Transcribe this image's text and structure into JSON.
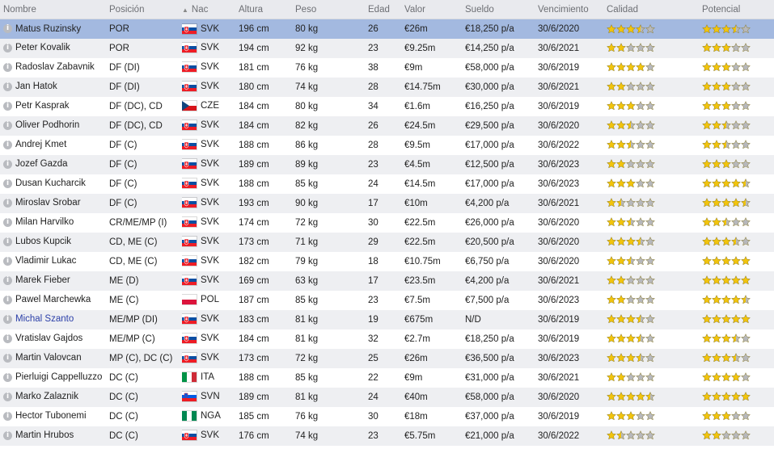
{
  "headers": {
    "name": "Nombre",
    "position": "Posición",
    "nation": "Nac",
    "height": "Altura",
    "weight": "Peso",
    "age": "Edad",
    "value": "Valor",
    "wage": "Sueldo",
    "expiry": "Vencimiento",
    "ability": "Calidad",
    "potential": "Potencial"
  },
  "sort_indicator": "▲",
  "colors": {
    "selected_row": "#a3b9e0",
    "alt_row": "#eeeff2",
    "star_gold": "#f2c40c",
    "star_grey": "#b7b8bc",
    "link": "#2b3fa8"
  },
  "players": [
    {
      "name": "Matus Ruzinsky",
      "pos": "POR",
      "nat": "SVK",
      "height": "196 cm",
      "weight": "80 kg",
      "age": "26",
      "value": "€26m",
      "wage": "€18,250 p/a",
      "expiry": "30/6/2020",
      "ability": 3.5,
      "potential": 3.5
    },
    {
      "name": "Peter Kovalik",
      "pos": "POR",
      "nat": "SVK",
      "height": "194 cm",
      "weight": "92 kg",
      "age": "23",
      "value": "€9.25m",
      "wage": "€14,250 p/a",
      "expiry": "30/6/2021",
      "ability": 2,
      "potential": 3
    },
    {
      "name": "Radoslav Zabavnik",
      "pos": "DF (DI)",
      "nat": "SVK",
      "height": "181 cm",
      "weight": "76 kg",
      "age": "38",
      "value": "€9m",
      "wage": "€58,000 p/a",
      "expiry": "30/6/2019",
      "ability": 4,
      "potential": 3
    },
    {
      "name": "Jan Hatok",
      "pos": "DF (DI)",
      "nat": "SVK",
      "height": "180 cm",
      "weight": "74 kg",
      "age": "28",
      "value": "€14.75m",
      "wage": "€30,000 p/a",
      "expiry": "30/6/2021",
      "ability": 2,
      "potential": 3
    },
    {
      "name": "Petr Kasprak",
      "pos": "DF (DC), CD",
      "nat": "CZE",
      "height": "184 cm",
      "weight": "80 kg",
      "age": "34",
      "value": "€1.6m",
      "wage": "€16,250 p/a",
      "expiry": "30/6/2019",
      "ability": 3,
      "potential": 3
    },
    {
      "name": "Oliver Podhorin",
      "pos": "DF (DC), CD",
      "nat": "SVK",
      "height": "184 cm",
      "weight": "82 kg",
      "age": "26",
      "value": "€24.5m",
      "wage": "€29,500 p/a",
      "expiry": "30/6/2020",
      "ability": 2.5,
      "potential": 2.5
    },
    {
      "name": "Andrej Kmet",
      "pos": "DF (C)",
      "nat": "SVK",
      "height": "188 cm",
      "weight": "86 kg",
      "age": "28",
      "value": "€9.5m",
      "wage": "€17,000 p/a",
      "expiry": "30/6/2022",
      "ability": 2.5,
      "potential": 2.5
    },
    {
      "name": "Jozef Gazda",
      "pos": "DF (C)",
      "nat": "SVK",
      "height": "189 cm",
      "weight": "89 kg",
      "age": "23",
      "value": "€4.5m",
      "wage": "€12,500 p/a",
      "expiry": "30/6/2023",
      "ability": 2,
      "potential": 3
    },
    {
      "name": "Dusan Kucharcik",
      "pos": "DF (C)",
      "nat": "SVK",
      "height": "188 cm",
      "weight": "85 kg",
      "age": "24",
      "value": "€14.5m",
      "wage": "€17,000 p/a",
      "expiry": "30/6/2023",
      "ability": 3,
      "potential": 4.5
    },
    {
      "name": "Miroslav Srobar",
      "pos": "DF (C)",
      "nat": "SVK",
      "height": "193 cm",
      "weight": "90 kg",
      "age": "17",
      "value": "€10m",
      "wage": "€4,200 p/a",
      "expiry": "30/6/2021",
      "ability": 1.5,
      "potential": 4.5
    },
    {
      "name": "Milan Harvilko",
      "pos": "CR/ME/MP (I)",
      "nat": "SVK",
      "height": "174 cm",
      "weight": "72 kg",
      "age": "30",
      "value": "€22.5m",
      "wage": "€26,000 p/a",
      "expiry": "30/6/2020",
      "ability": 2.5,
      "potential": 2.5
    },
    {
      "name": "Lubos Kupcik",
      "pos": "CD, ME (C)",
      "nat": "SVK",
      "height": "173 cm",
      "weight": "71 kg",
      "age": "29",
      "value": "€22.5m",
      "wage": "€20,500 p/a",
      "expiry": "30/6/2020",
      "ability": 3.5,
      "potential": 3.5
    },
    {
      "name": "Vladimir Lukac",
      "pos": "CD, ME (C)",
      "nat": "SVK",
      "height": "182 cm",
      "weight": "79 kg",
      "age": "18",
      "value": "€10.75m",
      "wage": "€6,750 p/a",
      "expiry": "30/6/2020",
      "ability": 2.5,
      "potential": 5
    },
    {
      "name": "Marek Fieber",
      "pos": "ME (D)",
      "nat": "SVK",
      "height": "169 cm",
      "weight": "63 kg",
      "age": "17",
      "value": "€23.5m",
      "wage": "€4,200 p/a",
      "expiry": "30/6/2021",
      "ability": 2,
      "potential": 5
    },
    {
      "name": "Pawel Marchewka",
      "pos": "ME (C)",
      "nat": "POL",
      "height": "187 cm",
      "weight": "85 kg",
      "age": "23",
      "value": "€7.5m",
      "wage": "€7,500 p/a",
      "expiry": "30/6/2023",
      "ability": 2,
      "potential": 4.5
    },
    {
      "name": "Michal Szanto",
      "pos": "ME/MP (DI)",
      "nat": "SVK",
      "height": "183 cm",
      "weight": "81 kg",
      "age": "19",
      "value": "€675m",
      "wage": "N/D",
      "expiry": "30/6/2019",
      "ability": 3.5,
      "potential": 5,
      "link": true
    },
    {
      "name": "Vratislav Gajdos",
      "pos": "ME/MP (C)",
      "nat": "SVK",
      "height": "184 cm",
      "weight": "81 kg",
      "age": "32",
      "value": "€2.7m",
      "wage": "€18,250 p/a",
      "expiry": "30/6/2019",
      "ability": 3.5,
      "potential": 3.5
    },
    {
      "name": "Martin Valovcan",
      "pos": "MP (C), DC (C)",
      "nat": "SVK",
      "height": "173 cm",
      "weight": "72 kg",
      "age": "25",
      "value": "€26m",
      "wage": "€36,500 p/a",
      "expiry": "30/6/2023",
      "ability": 3.5,
      "potential": 3.5
    },
    {
      "name": "Pierluigi Cappelluzzo",
      "pos": "DC (C)",
      "nat": "ITA",
      "height": "188 cm",
      "weight": "85 kg",
      "age": "22",
      "value": "€9m",
      "wage": "€31,000 p/a",
      "expiry": "30/6/2021",
      "ability": 2,
      "potential": 4
    },
    {
      "name": "Marko Zalaznik",
      "pos": "DC (C)",
      "nat": "SVN",
      "height": "189 cm",
      "weight": "81 kg",
      "age": "24",
      "value": "€40m",
      "wage": "€58,000 p/a",
      "expiry": "30/6/2020",
      "ability": 4.5,
      "potential": 5
    },
    {
      "name": "Hector Tubonemi",
      "pos": "DC (C)",
      "nat": "NGA",
      "height": "185 cm",
      "weight": "76 kg",
      "age": "30",
      "value": "€18m",
      "wage": "€37,000 p/a",
      "expiry": "30/6/2019",
      "ability": 3,
      "potential": 3
    },
    {
      "name": "Martin Hrubos",
      "pos": "DC (C)",
      "nat": "SVK",
      "height": "176 cm",
      "weight": "74 kg",
      "age": "23",
      "value": "€5.75m",
      "wage": "€21,000 p/a",
      "expiry": "30/6/2022",
      "ability": 1.5,
      "potential": 2
    }
  ]
}
